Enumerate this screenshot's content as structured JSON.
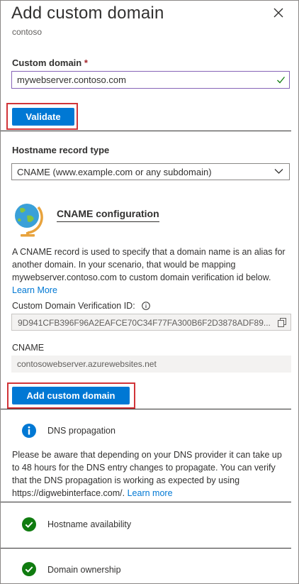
{
  "header": {
    "title": "Add custom domain",
    "subtitle": "contoso"
  },
  "custom_domain": {
    "label": "Custom domain",
    "required_marker": "*",
    "value": "mywebserver.contoso.com"
  },
  "validate_button": {
    "label": "Validate"
  },
  "record_type": {
    "label": "Hostname record type",
    "selected": "CNAME (www.example.com or any subdomain)"
  },
  "cname_config": {
    "title": "CNAME configuration",
    "description": "A CNAME record is used to specify that a domain name is an alias for another domain. In your scenario, that would be mapping mywebserver.contoso.com to custom domain verification id below.",
    "learn_more": "Learn More"
  },
  "verification": {
    "label": "Custom Domain Verification ID:",
    "value": "9D941CFB396F96A2EAFCE70C34F77FA300B6F2D3878ADF89..."
  },
  "cname": {
    "label": "CNAME",
    "value": "contosowebserver.azurewebsites.net"
  },
  "add_button": {
    "label": "Add custom domain"
  },
  "dns_propagation": {
    "label": "DNS propagation",
    "message": "Please be aware that depending on your DNS provider it can take up to 48 hours for the DNS entry changes to propagate. You can verify that the DNS propagation is working as expected by using https://digwebinterface.com/.",
    "learn_more": "Learn more"
  },
  "checks": [
    {
      "label": "Hostname availability",
      "status": "success"
    },
    {
      "label": "Domain ownership",
      "status": "success"
    }
  ],
  "colors": {
    "accent": "#0078d4",
    "success": "#107c10",
    "highlight": "#d13438",
    "focus_border": "#8764b8"
  },
  "icons": [
    "close-icon",
    "checkmark-icon",
    "chevron-down-icon",
    "globe-icon",
    "info-icon",
    "copy-icon",
    "success-check-icon"
  ]
}
